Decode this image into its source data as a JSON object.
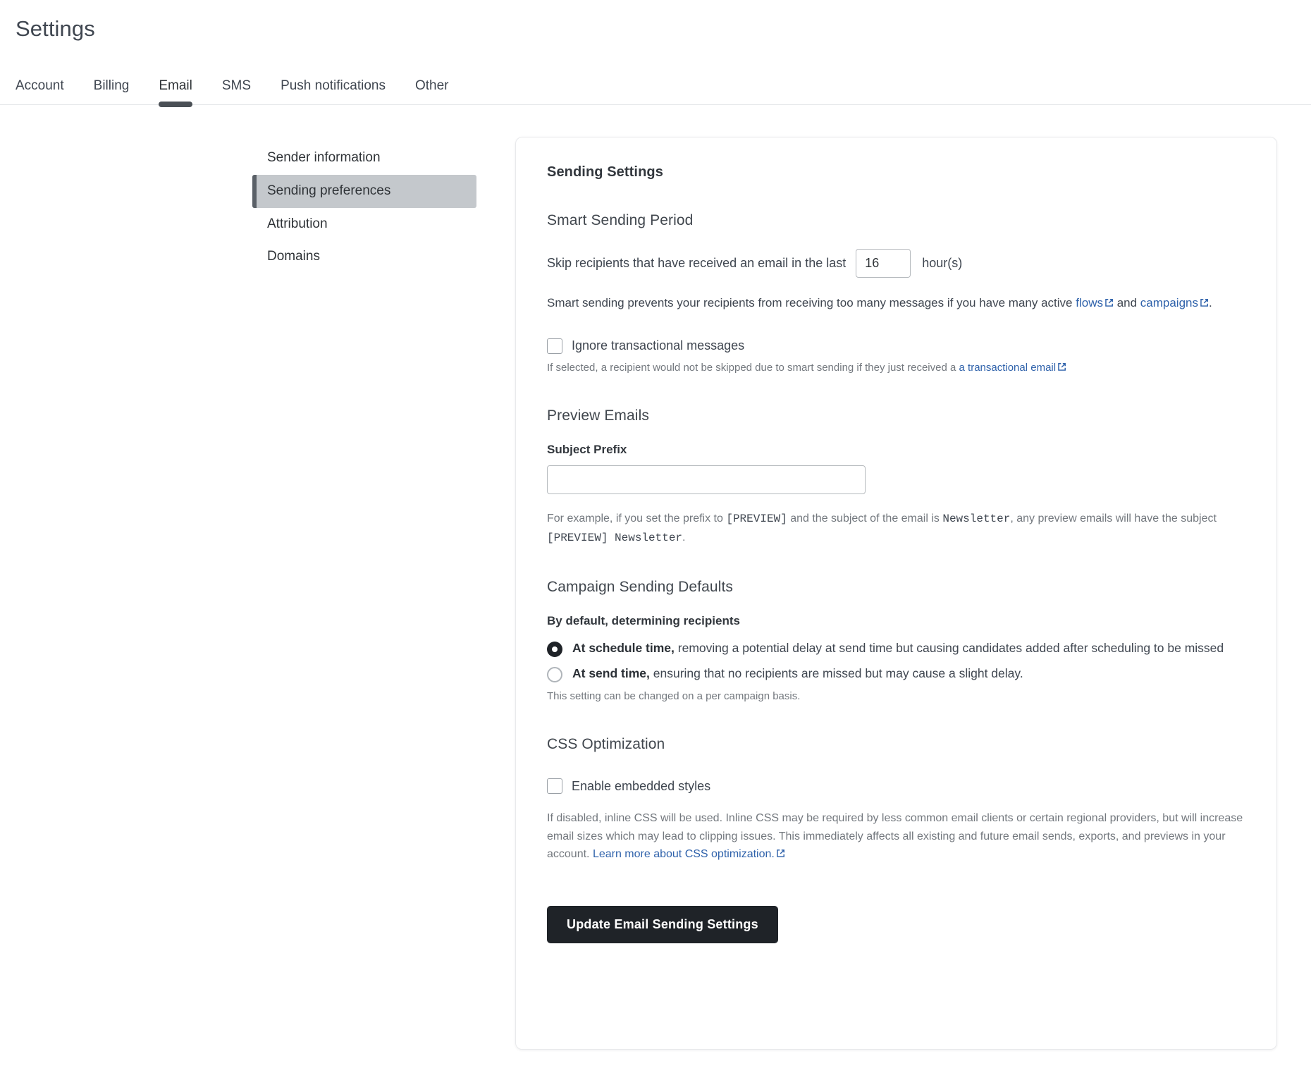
{
  "header": {
    "title": "Settings",
    "tabs": [
      {
        "label": "Account",
        "active": false
      },
      {
        "label": "Billing",
        "active": false
      },
      {
        "label": "Email",
        "active": true
      },
      {
        "label": "SMS",
        "active": false
      },
      {
        "label": "Push notifications",
        "active": false
      },
      {
        "label": "Other",
        "active": false
      }
    ]
  },
  "sidenav": {
    "items": [
      {
        "label": "Sender information",
        "active": false
      },
      {
        "label": "Sending preferences",
        "active": true
      },
      {
        "label": "Attribution",
        "active": false
      },
      {
        "label": "Domains",
        "active": false
      }
    ]
  },
  "card": {
    "title": "Sending Settings",
    "smart_sending": {
      "heading": "Smart Sending Period",
      "skip_lead": "Skip recipients that have received an email in the last",
      "hours_value": "16",
      "hours_placeholder": "",
      "skip_trail": "hour(s)",
      "description_part1": "Smart sending prevents your recipients from receiving too many messages if you have many active ",
      "link_flows": "flows",
      "description_part2": " and ",
      "link_campaigns": "campaigns",
      "description_part3": ".",
      "ignore_checkbox_label": "Ignore transactional messages",
      "ignore_checked": false,
      "ignore_hint_part1": "If selected, a recipient would not be skipped due to smart sending if they just received a ",
      "ignore_hint_link": "a transactional email"
    },
    "preview_emails": {
      "heading": "Preview Emails",
      "subject_prefix_label": "Subject Prefix",
      "subject_prefix_value": "",
      "subject_prefix_placeholder": "",
      "example_part1": "For example, if you set the prefix to ",
      "example_code1": "[PREVIEW]",
      "example_part2": " and the subject of the email is ",
      "example_code2": "Newsletter",
      "example_part3": ", any preview emails will have the subject ",
      "example_code3": "[PREVIEW] Newsletter",
      "example_part4": "."
    },
    "campaign_defaults": {
      "heading": "Campaign Sending Defaults",
      "field_label": "By default, determining recipients",
      "options": [
        {
          "bold": "At schedule time,",
          "rest": " removing a potential delay at send time but causing candidates added after scheduling to be missed",
          "selected": true
        },
        {
          "bold": "At send time,",
          "rest": " ensuring that no recipients are missed but may cause a slight delay.",
          "selected": false
        }
      ],
      "hint": "This setting can be changed on a per campaign basis."
    },
    "css_optimization": {
      "heading": "CSS Optimization",
      "checkbox_label": "Enable embedded styles",
      "checked": false,
      "description_part1": "If disabled, inline CSS will be used. Inline CSS may be required by less common email clients or certain regional providers, but will increase email sizes which may lead to clipping issues. This immediately affects all existing and future email sends, exports, and previews in your account. ",
      "description_link": "Learn more about CSS optimization."
    },
    "submit_label": "Update Email Sending Settings"
  },
  "colors": {
    "accent_link": "#2f62ab",
    "button_bg": "#1f2328",
    "sidenav_active_bg": "#c4c8cc",
    "sidenav_active_bar": "#5a6067",
    "tab_underline": "#4a4f55"
  }
}
